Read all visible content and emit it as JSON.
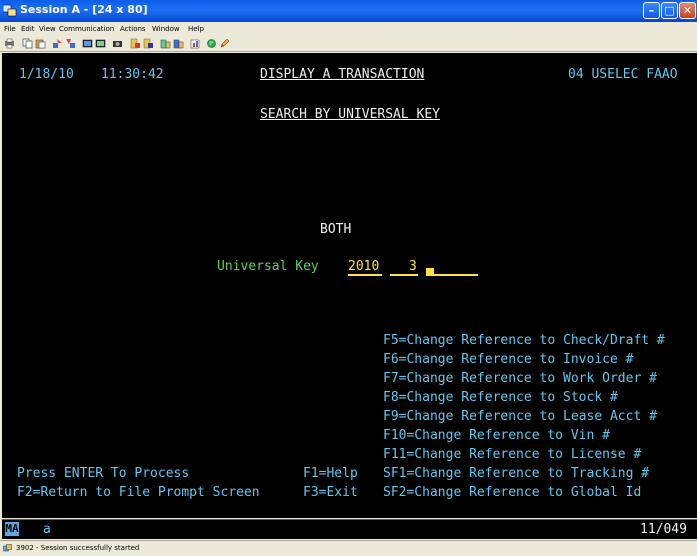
{
  "window": {
    "title": "Session A - [24 x 80]",
    "min_glyph": "–",
    "max_glyph": "□",
    "close_glyph": "✕"
  },
  "menu": [
    "File",
    "Edit",
    "View",
    "Communication",
    "Actions",
    "Window",
    "Help"
  ],
  "toolbar_icons": [
    "print-icon",
    "copy-icon",
    "paste-icon",
    "send-icon",
    "receive-icon",
    "display-icon",
    "settings-icon",
    "record-icon",
    "macro-play-icon",
    "stop-icon",
    "clipboard-icon",
    "map-icon",
    "chart-icon",
    "globe-icon",
    "edit-icon"
  ],
  "terminal": {
    "date": "1/18/10",
    "time": "11:30:42",
    "screen_title": "DISPLAY A TRANSACTION",
    "system_id": "04 USELEC FAAO",
    "subtitle": "SEARCH BY UNIVERSAL KEY",
    "mode": "BOTH",
    "field_label": "Universal Key",
    "field_year": "2010",
    "field_seq": "3",
    "options": [
      "F5=Change Reference to Check/Draft #",
      "F6=Change Reference to Invoice #",
      "F7=Change Reference to Work Order #",
      "F8=Change Reference to Stock #",
      "F9=Change Reference to Lease Acct #",
      "F10=Change Reference to Vin #",
      "F11=Change Reference to License #",
      "SF1=Change Reference to Tracking #",
      "SF2=Change Reference to Global Id"
    ],
    "footer_enter": "Press ENTER To Process",
    "footer_f1": "F1=Help",
    "footer_f2": "F2=Return to File Prompt Screen",
    "footer_f3": "F3=Exit"
  },
  "oia": {
    "indicator": "MA",
    "input_char": "a",
    "cursor_pos": "11/049"
  },
  "status": {
    "text": "3902 - Session successfully started"
  },
  "colors": {
    "titlebar": "#0a5ee8",
    "terminal_bg": "#000000",
    "cyan": "#62c6ee",
    "green": "#5ad25a",
    "yellow": "#ffe23a"
  }
}
